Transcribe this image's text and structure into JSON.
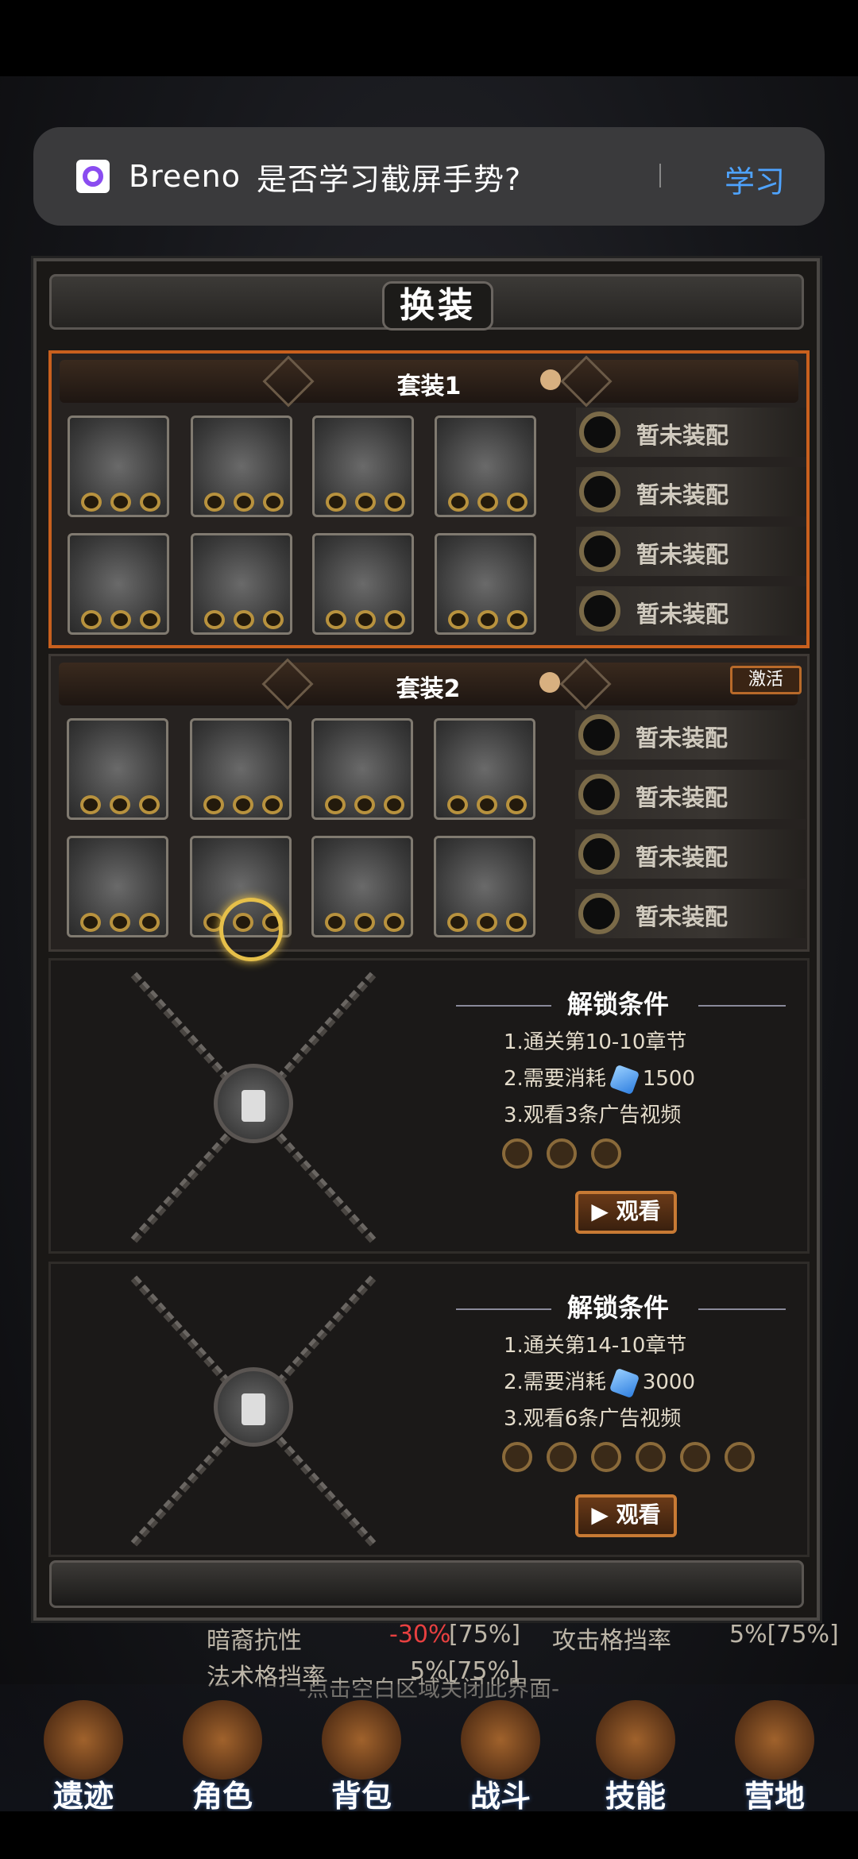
{
  "toast": {
    "app": "Breeno",
    "message": "是否学习截屏手势?",
    "action": "学习"
  },
  "panel": {
    "title": "换装",
    "close_hint": "-点击空白区域关闭此界面-"
  },
  "suits": [
    {
      "name": "套装1",
      "activate": "",
      "accessories": [
        "暂未装配",
        "暂未装配",
        "暂未装配",
        "暂未装配"
      ]
    },
    {
      "name": "套装2",
      "activate": "激活",
      "accessories": [
        "暂未装配",
        "暂未装配",
        "暂未装配",
        "暂未装配"
      ]
    }
  ],
  "locked": [
    {
      "title": "解锁条件",
      "c1": "1.通关第10-10章节",
      "c2_label": "2.需要消耗",
      "c2_value": "1500",
      "c3": "3.观看3条广告视频",
      "watch": "观看"
    },
    {
      "title": "解锁条件",
      "c1": "1.通关第14-10章节",
      "c2_label": "2.需要消耗",
      "c2_value": "3000",
      "c3": "3.观看6条广告视频",
      "watch": "观看"
    }
  ],
  "background_stats": {
    "r1_label": "暗裔抗性",
    "r1_value": "-30%",
    "r1_cap": "[75%]",
    "r1b_label": "攻击格挡率",
    "r1b_value": "5%[75%]",
    "r2_label": "法术格挡率",
    "r2_value": "5%[75%]"
  },
  "nav": [
    "遗迹",
    "角色",
    "背包",
    "战斗",
    "技能",
    "营地"
  ]
}
